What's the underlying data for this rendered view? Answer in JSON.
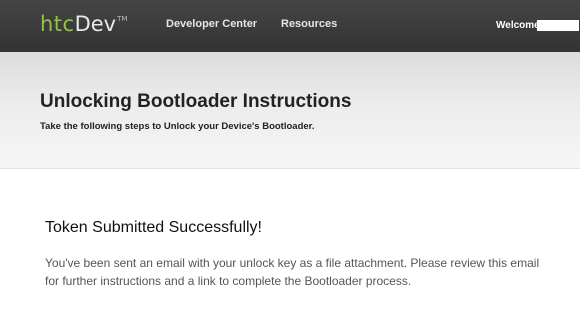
{
  "topbar": {
    "logo": {
      "primary": "htc",
      "secondary": "Dev",
      "trademark": "TM"
    },
    "nav": [
      {
        "label": "Developer Center"
      },
      {
        "label": "Resources"
      }
    ],
    "welcome_label": "Welcome,"
  },
  "header": {
    "title": "Unlocking Bootloader Instructions",
    "subtitle": "Take the following steps to Unlock your Device's Bootloader."
  },
  "main": {
    "heading": "Token Submitted Successfully!",
    "message": "You've been sent an email with your unlock key as a file attachment. Please review this email for further instructions and a link to complete the Bootloader process."
  },
  "colors": {
    "topbar": "#3a3a3a",
    "logo_green": "#8dc63f"
  }
}
